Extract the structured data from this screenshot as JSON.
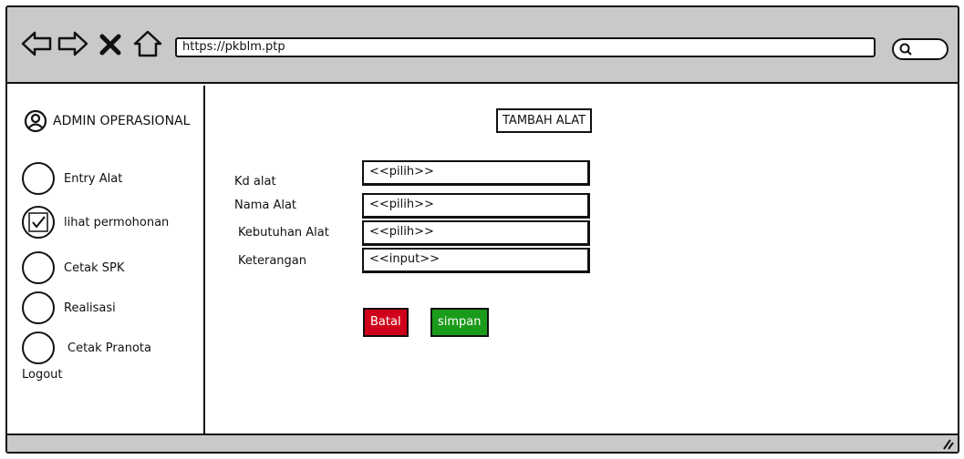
{
  "browser": {
    "url": "https://pkblm.ptp",
    "icons": [
      "back-arrow-icon",
      "forward-arrow-icon",
      "close-icon",
      "home-icon",
      "search-icon"
    ]
  },
  "sidebar": {
    "user_label": "ADMIN OPERASIONAL",
    "items": [
      {
        "label": "Entry Alat",
        "checked": false
      },
      {
        "label": "lihat permohonan",
        "checked": true
      },
      {
        "label": "Cetak SPK",
        "checked": false
      },
      {
        "label": "Realisasi",
        "checked": false
      },
      {
        "label": "Cetak Pranota",
        "checked": false
      }
    ],
    "logout_label": "Logout"
  },
  "main": {
    "title": "TAMBAH ALAT",
    "form": {
      "fields": [
        {
          "label": "Kd alat",
          "value": "<<pilih>>"
        },
        {
          "label": "Nama Alat",
          "value": "<<pilih>>"
        },
        {
          "label": "Kebutuhan Alat",
          "value": "<<pilih>>"
        },
        {
          "label": "Keterangan",
          "value": "<<input>>"
        }
      ]
    },
    "buttons": {
      "cancel_label": "Batal",
      "save_label": "simpan"
    }
  },
  "colors": {
    "chrome": "#c9c9c9",
    "cancel": "#d0021b",
    "save": "#1a9b1a"
  }
}
